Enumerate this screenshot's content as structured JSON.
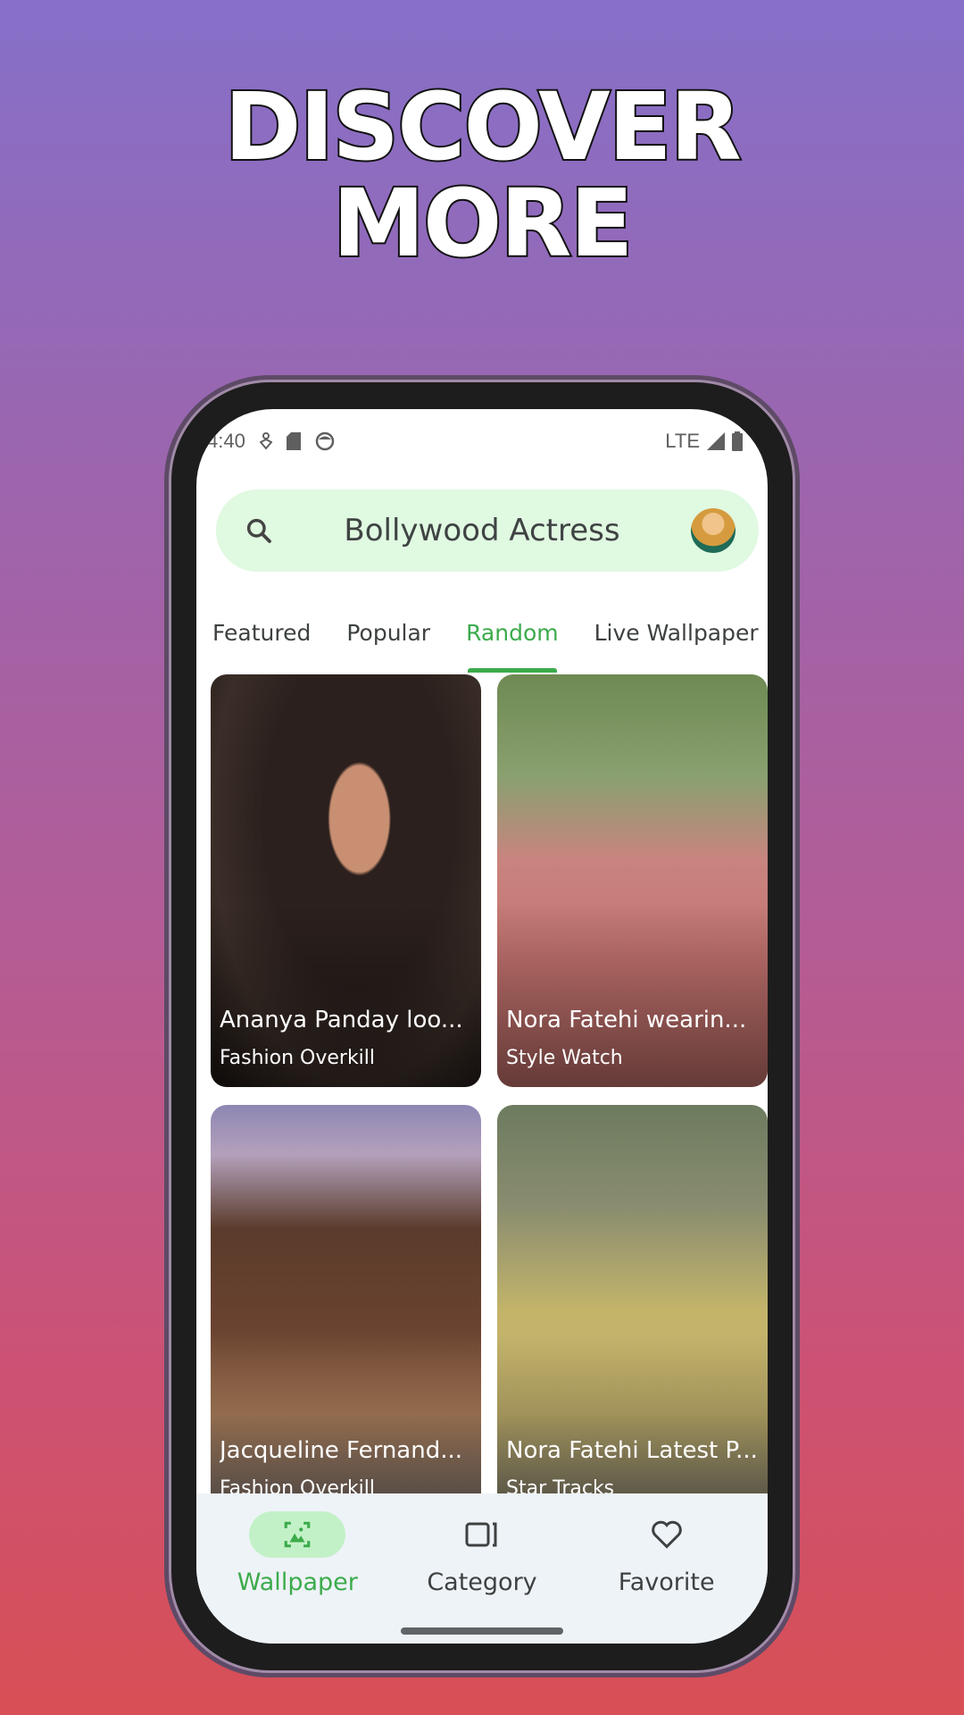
{
  "promo": {
    "headline_line1": "DISCOVER",
    "headline_line2": "MORE"
  },
  "status_bar": {
    "time": "4:40",
    "network": "LTE"
  },
  "search": {
    "label": "Bollywood Actress",
    "icon": "search-icon"
  },
  "tabs": [
    {
      "label": "Featured",
      "active": false
    },
    {
      "label": "Popular",
      "active": false
    },
    {
      "label": "Random",
      "active": true
    },
    {
      "label": "Live Wallpaper",
      "active": false
    }
  ],
  "cards": [
    {
      "title": "Ananya Panday loo...",
      "source": "Fashion Overkill"
    },
    {
      "title": "Nora Fatehi wearin...",
      "source": "Style Watch"
    },
    {
      "title": "Jacqueline Fernand...",
      "source": "Fashion Overkill"
    },
    {
      "title": "Nora Fatehi Latest P...",
      "source": "Star Tracks"
    }
  ],
  "bottom_nav": [
    {
      "label": "Wallpaper",
      "icon": "wallpaper-icon",
      "active": true
    },
    {
      "label": "Category",
      "icon": "category-icon",
      "active": false
    },
    {
      "label": "Favorite",
      "icon": "heart-icon",
      "active": false
    }
  ],
  "colors": {
    "accent": "#3cab4b",
    "search_bg": "#e0f9e1",
    "nav_bg": "#eef3f8"
  }
}
